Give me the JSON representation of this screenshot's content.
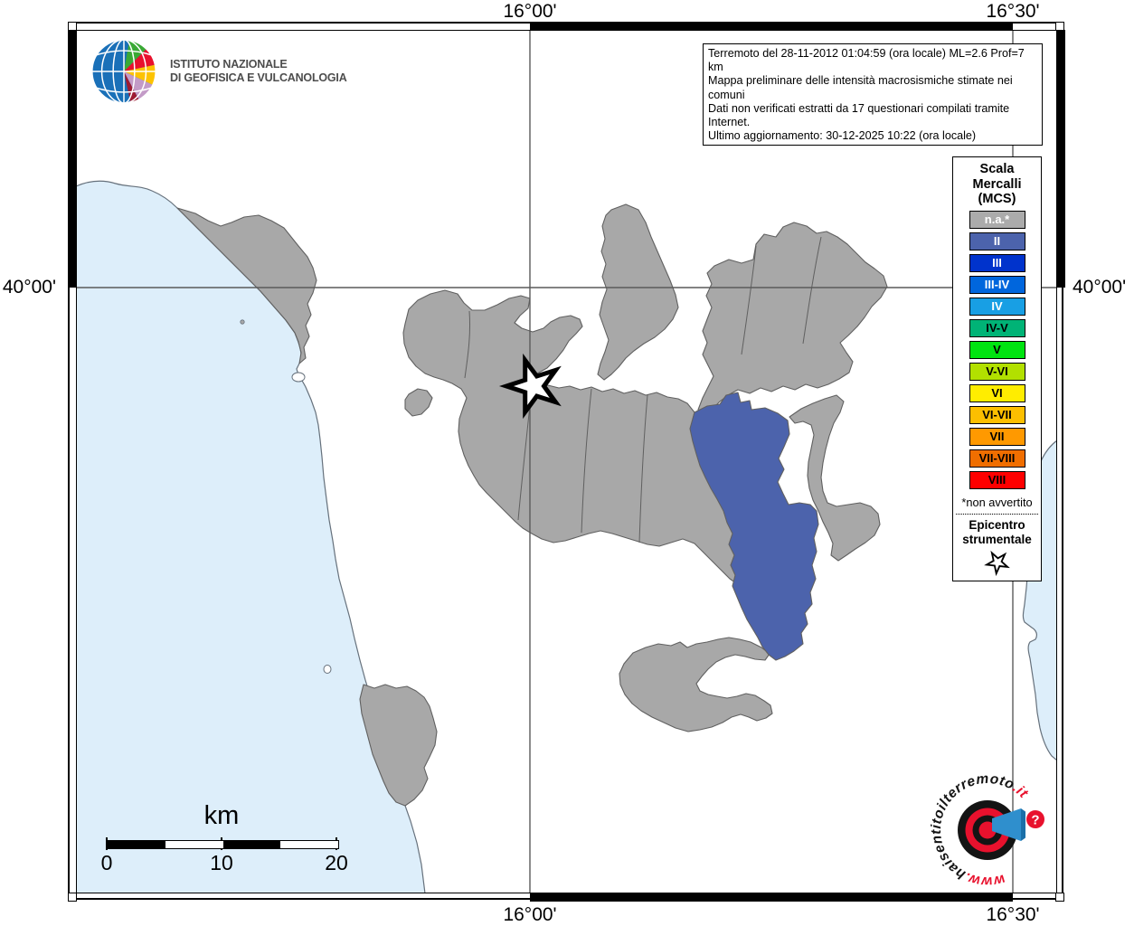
{
  "ingv": {
    "name_line1": "ISTITUTO NAZIONALE",
    "name_line2": "DI GEOFISICA E VULCANOLOGIA"
  },
  "info_box": {
    "lines": [
      "Terremoto del 28-11-2012 01:04:59 (ora locale) ML=2.6 Prof=7 km",
      "Mappa preliminare delle intensità macrosismiche stimate nei comuni",
      "Dati non verificati estratti da 17 questionari compilati tramite Internet.",
      "Ultimo aggiornamento: 30-12-2025 10:22 (ora locale)"
    ]
  },
  "coordinates": {
    "lon_west": "16°00'",
    "lon_east": "16°30'",
    "lat": "40°00'"
  },
  "legend": {
    "title_lines": [
      "Scala",
      "Mercalli",
      "(MCS)"
    ],
    "items": [
      {
        "label": "n.a.*",
        "color": "#ababab",
        "text_color": "#ffffff"
      },
      {
        "label": "II",
        "color": "#4c63ac",
        "text_color": "#ffffff"
      },
      {
        "label": "III",
        "color": "#0033cc",
        "text_color": "#ffffff"
      },
      {
        "label": "III-IV",
        "color": "#0066dd",
        "text_color": "#ffffff"
      },
      {
        "label": "IV",
        "color": "#189fe4",
        "text_color": "#ffffff"
      },
      {
        "label": "IV-V",
        "color": "#00b376",
        "text_color": "#000000"
      },
      {
        "label": "V",
        "color": "#00e410",
        "text_color": "#000000"
      },
      {
        "label": "V-VI",
        "color": "#b2e000",
        "text_color": "#000000"
      },
      {
        "label": "VI",
        "color": "#ffed00",
        "text_color": "#000000"
      },
      {
        "label": "VI-VII",
        "color": "#fcbf00",
        "text_color": "#000000"
      },
      {
        "label": "VII",
        "color": "#ff9900",
        "text_color": "#000000"
      },
      {
        "label": "VII-VIII",
        "color": "#f06e00",
        "text_color": "#000000"
      },
      {
        "label": "VIII",
        "color": "#fe0000",
        "text_color": "#000000"
      }
    ],
    "footnote": "*non avvertito",
    "epicenter_line1": "Epicentro",
    "epicenter_line2": "strumentale",
    "epicenter_icon": "star-outline"
  },
  "scale_bar": {
    "title": "km",
    "tick_labels": [
      "0",
      "10",
      "20"
    ]
  },
  "watermark": {
    "prefix": "www.",
    "domain": "haisentitoilterremoto",
    "tld": ".it",
    "question_mark": "?"
  },
  "theme_colors": {
    "sea": "#ddeefa",
    "coast": "#66717c",
    "muni-gray": "#a8a8a8",
    "muni-border": "#606060",
    "muni-blue": "#4c63ac",
    "grid": "#5a5a5a",
    "ingv-text": "#4d4d4d",
    "logo-red": "#e8112d",
    "logo-dark": "#141414",
    "logo-blue": "#2f8fcd"
  }
}
